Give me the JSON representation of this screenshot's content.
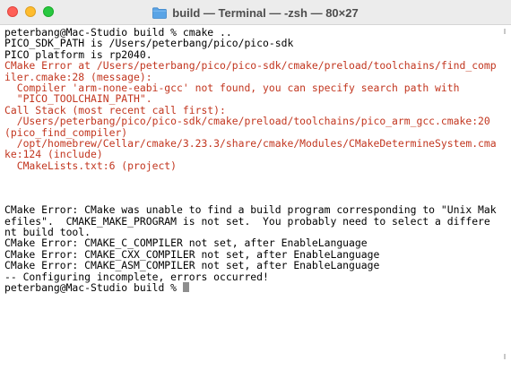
{
  "window": {
    "title": "build — Terminal — -zsh — 80×27",
    "title_icon": "folder-icon",
    "close_color": "#fe5f57",
    "minimize_color": "#febc2e",
    "zoom_color": "#28c840"
  },
  "terminal": {
    "error_color": "#c2361f",
    "prompt": "peterbang@Mac-Studio build % ",
    "lines": [
      {
        "text": "peterbang@Mac-Studio build % cmake ..",
        "style": "normal"
      },
      {
        "text": "PICO_SDK_PATH is /Users/peterbang/pico/pico-sdk",
        "style": "normal"
      },
      {
        "text": "PICO platform is rp2040.",
        "style": "normal"
      },
      {
        "text": "CMake Error at /Users/peterbang/pico/pico-sdk/cmake/preload/toolchains/find_comp",
        "style": "error"
      },
      {
        "text": "iler.cmake:28 (message):",
        "style": "error"
      },
      {
        "text": "  Compiler 'arm-none-eabi-gcc' not found, you can specify search path with",
        "style": "error"
      },
      {
        "text": "  \"PICO_TOOLCHAIN_PATH\".",
        "style": "error"
      },
      {
        "text": "Call Stack (most recent call first):",
        "style": "error"
      },
      {
        "text": "  /Users/peterbang/pico/pico-sdk/cmake/preload/toolchains/pico_arm_gcc.cmake:20",
        "style": "error"
      },
      {
        "text": "(pico_find_compiler)",
        "style": "error"
      },
      {
        "text": "  /opt/homebrew/Cellar/cmake/3.23.3/share/cmake/Modules/CMakeDetermineSystem.cma",
        "style": "error"
      },
      {
        "text": "ke:124 (include)",
        "style": "error"
      },
      {
        "text": "  CMakeLists.txt:6 (project)",
        "style": "error"
      },
      {
        "text": "",
        "style": "normal"
      },
      {
        "text": "",
        "style": "normal"
      },
      {
        "text": "",
        "style": "normal"
      },
      {
        "text": "CMake Error: CMake was unable to find a build program corresponding to \"Unix Mak",
        "style": "normal"
      },
      {
        "text": "efiles\".  CMAKE_MAKE_PROGRAM is not set.  You probably need to select a differe",
        "style": "normal"
      },
      {
        "text": "nt build tool.",
        "style": "normal"
      },
      {
        "text": "CMake Error: CMAKE_C_COMPILER not set, after EnableLanguage",
        "style": "normal"
      },
      {
        "text": "CMake Error: CMAKE_CXX_COMPILER not set, after EnableLanguage",
        "style": "normal"
      },
      {
        "text": "CMake Error: CMAKE_ASM_COMPILER not set, after EnableLanguage",
        "style": "normal"
      },
      {
        "text": "-- Configuring incomplete, errors occurred!",
        "style": "normal"
      }
    ]
  }
}
